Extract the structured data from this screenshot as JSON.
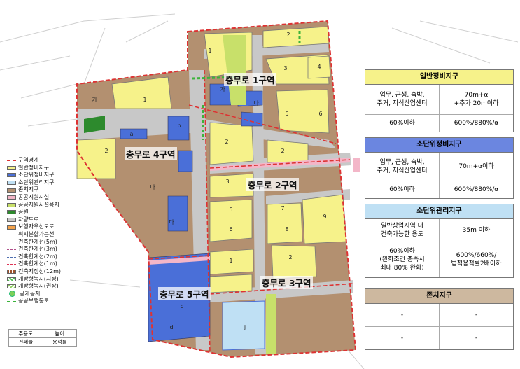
{
  "zones": {
    "z1": "충무로 1구역",
    "z2": "충무로 2구역",
    "z3": "충무로 3구역",
    "z4": "충무로 4구역",
    "z5": "충무로 5구역"
  },
  "legend": [
    {
      "icon": "boundary-line-icon",
      "label": "구역경계",
      "color": "#d33"
    },
    {
      "icon": "yellow-swatch-icon",
      "label": "일반정비지구",
      "color": "#f6f28a"
    },
    {
      "icon": "blue-swatch-icon",
      "label": "소단위정비지구",
      "color": "#4a6fd8"
    },
    {
      "icon": "lightblue-swatch-icon",
      "label": "소단위관리지구",
      "color": "#bfe0f4"
    },
    {
      "icon": "brown-swatch-icon",
      "label": "존치지구",
      "color": "#b39070"
    },
    {
      "icon": "pink-swatch-icon",
      "label": "공공지원시설",
      "color": "#f3b6c8"
    },
    {
      "icon": "lime-swatch-icon",
      "label": "공공지원시설용지",
      "color": "#c8e06a"
    },
    {
      "icon": "green-swatch-icon",
      "label": "공원",
      "color": "#2d8a2d"
    },
    {
      "icon": "gray-swatch-icon",
      "label": "차량도로",
      "color": "#c8c8c8"
    },
    {
      "icon": "orange-swatch-icon",
      "label": "보행자우선도로",
      "color": "#f3a24b"
    },
    {
      "icon": "dashed-line-icon",
      "label": "획지분할가능선",
      "color": "#555"
    },
    {
      "icon": "dashed-line-icon",
      "label": "건축한계선(5m)",
      "color": "#8a4fb0"
    },
    {
      "icon": "dashed-line-icon",
      "label": "건축한계선(3m)",
      "color": "#b04f8a"
    },
    {
      "icon": "dashed-line-icon",
      "label": "건축한계선(2m)",
      "color": "#4f6fb0"
    },
    {
      "icon": "dashed-line-icon",
      "label": "건축한계선(1m)",
      "color": "#d35"
    },
    {
      "icon": "hatched-line-icon",
      "label": "건축지정선(12m)",
      "color": "#a0522d"
    },
    {
      "icon": "green-hatch-icon",
      "label": "개방형녹지(지정)",
      "color": "#4cbf4c"
    },
    {
      "icon": "green-hatch-icon",
      "label": "개방형녹지(권장)",
      "color": "#8ad05a"
    },
    {
      "icon": "green-dot-icon",
      "label": "공개공지",
      "color": "#7ccf5a"
    },
    {
      "icon": "green-dashed-icon",
      "label": "공공보행통로",
      "color": "#3bb33b"
    }
  ],
  "key": {
    "a": "주용도",
    "b": "높이",
    "c": "건폐율",
    "d": "용적률"
  },
  "panels": {
    "general": {
      "title": "일반정비지구",
      "r1c1": "업무, 근생, 숙박,\n주거, 지식산업센터",
      "r1c2": "70m+α\n+추가 20m이하",
      "r2c1": "60%이하",
      "r2c2": "600%/880%/α"
    },
    "small": {
      "title": "소단위정비지구",
      "r1c1": "업무, 근생, 숙박,\n주거, 지식산업센터",
      "r1c2": "70m+α이하",
      "r2c1": "60%이하",
      "r2c2": "600%/880%/α"
    },
    "mgmt": {
      "title": "소단위관리지구",
      "r1c1": "일반상업지역 내\n건축가능한 용도",
      "r1c2": "35m 이하",
      "r2c1": "60%이하\n(완화조건 충족시\n최대 80% 완화)",
      "r2c2": "600%/660%/\n법적용적률2배이하"
    },
    "keep": {
      "title": "존치지구",
      "r1c1": "-",
      "r1c2": "-",
      "r2c1": "-",
      "r2c2": "-"
    }
  },
  "blocks": [
    "1",
    "2",
    "3",
    "4",
    "5",
    "6",
    "7",
    "8",
    "9",
    "가",
    "나",
    "다",
    "라",
    "마",
    "a",
    "b",
    "c",
    "d",
    "j"
  ],
  "colors": {
    "general": "#f6f28a",
    "small": "#4a6fd8",
    "mgmt": "#bfe0f4",
    "keep": "#b39070",
    "road": "#c8c8c8"
  }
}
